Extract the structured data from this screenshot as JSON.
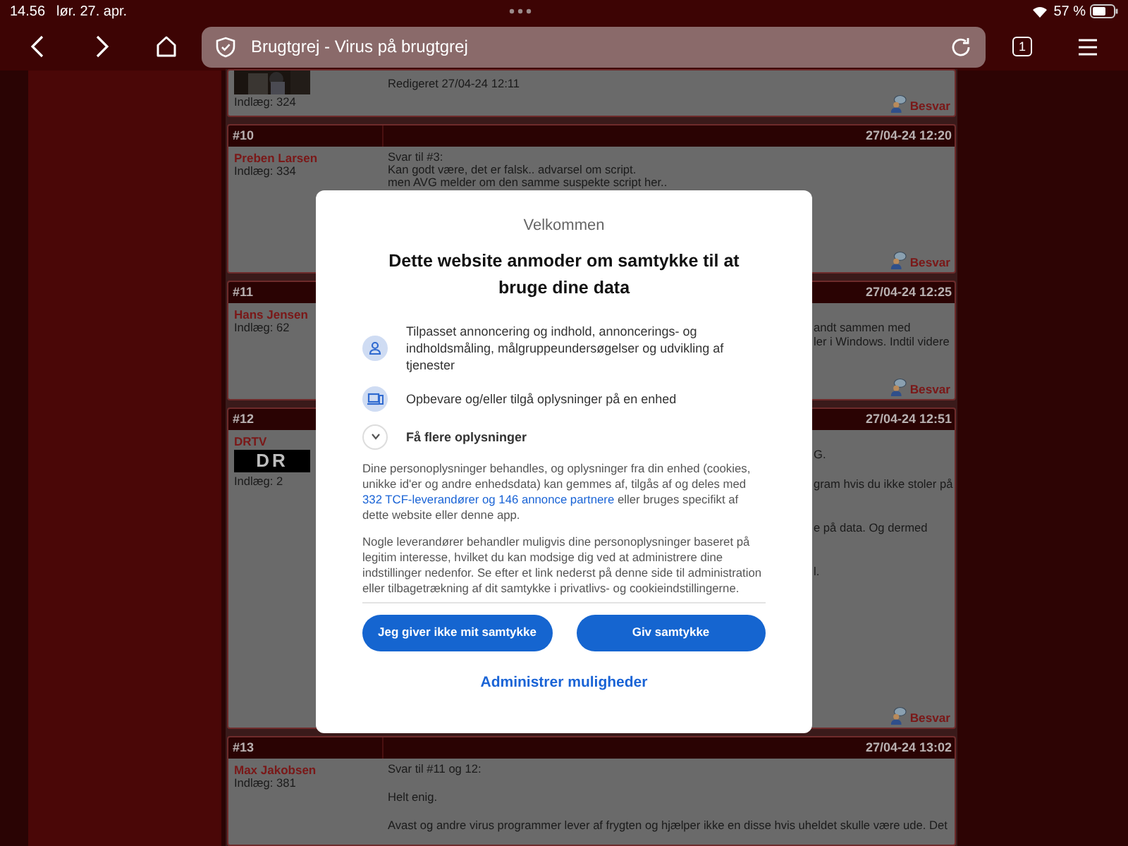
{
  "status_bar": {
    "time": "14.56",
    "date": "lør. 27. apr.",
    "battery": "57 %"
  },
  "browser": {
    "title": "Brugtgrej - Virus på brugtgrej",
    "tab_count": "1"
  },
  "posts": [
    {
      "avatar": {
        "kind": "picture"
      },
      "post_count": "Indlæg: 324",
      "lines": [
        "Redigeret 27/04-24 12:11"
      ],
      "reply": "Besvar"
    },
    {
      "number": "#10",
      "date": "27/04-24 12:20",
      "author": "Preben Larsen",
      "post_count": "Indlæg: 334",
      "lines": [
        "Svar til #3:",
        "Kan godt være, det er falsk.. advarsel om script.",
        "men AVG melder om den samme suspekte script her.."
      ],
      "reply": "Besvar"
    },
    {
      "number": "#11",
      "date": "27/04-24 12:25",
      "author": "Hans Jensen",
      "post_count": "Indlæg: 62",
      "fragments": [
        "andt sammen med",
        "ler i Windows. Indtil videre"
      ],
      "reply": "Besvar"
    },
    {
      "number": "#12",
      "date": "27/04-24 12:51",
      "author": "DRTV",
      "logo": "DR",
      "post_count": "Indlæg: 2",
      "fragments": [
        "G.",
        "gram hvis du ikke stoler på",
        "e på data. Og dermed",
        "l."
      ],
      "reply": "Besvar"
    },
    {
      "number": "#13",
      "date": "27/04-24 13:02",
      "author": "Max Jakobsen",
      "post_count": "Indlæg: 381",
      "lines": [
        "Svar til #11 og 12:",
        "Helt enig.",
        "Avast og andre virus programmer lever af frygten og hjælper ikke en disse hvis uheldet skulle være ude. Det"
      ]
    }
  ],
  "consent": {
    "eyebrow": "Velkommen",
    "title": "Dette website anmoder om samtykke til at bruge dine data",
    "purposes": [
      {
        "kind": "person",
        "text": "Tilpasset annoncering og indhold, annoncerings- og indholdsmåling, målgruppeundersøgelser og udvikling af tjenester"
      },
      {
        "kind": "device",
        "text": "Opbevare og/eller tilgå oplysninger på en enhed"
      },
      {
        "kind": "expand",
        "text": "Få flere oplysninger",
        "expanded": false
      }
    ],
    "paragraph_1_before": "Dine personoplysninger behandles, og oplysninger fra din enhed (cookies, unikke id'er og andre enhedsdata) kan gemmes af, tilgås af og deles med",
    "paragraph_1_link": "332 TCF-leverandører og 146 annonce partnere",
    "paragraph_1_after": "eller bruges specifikt af dette website eller denne app.",
    "paragraph_2": "Nogle leverandører behandler muligvis dine personoplysninger baseret på legitim interesse, hvilket du kan modsige dig ved at administrere dine indstillinger nedenfor. Se efter et link nederst på denne side til administration eller tilbagetrækning af dit samtykke i privatlivs- og cookieindstillingerne.",
    "buttons": [
      "Jeg giver ikke mit samtykke",
      "Giv samtykke"
    ],
    "manage_link": "Administrer muligheder"
  }
}
